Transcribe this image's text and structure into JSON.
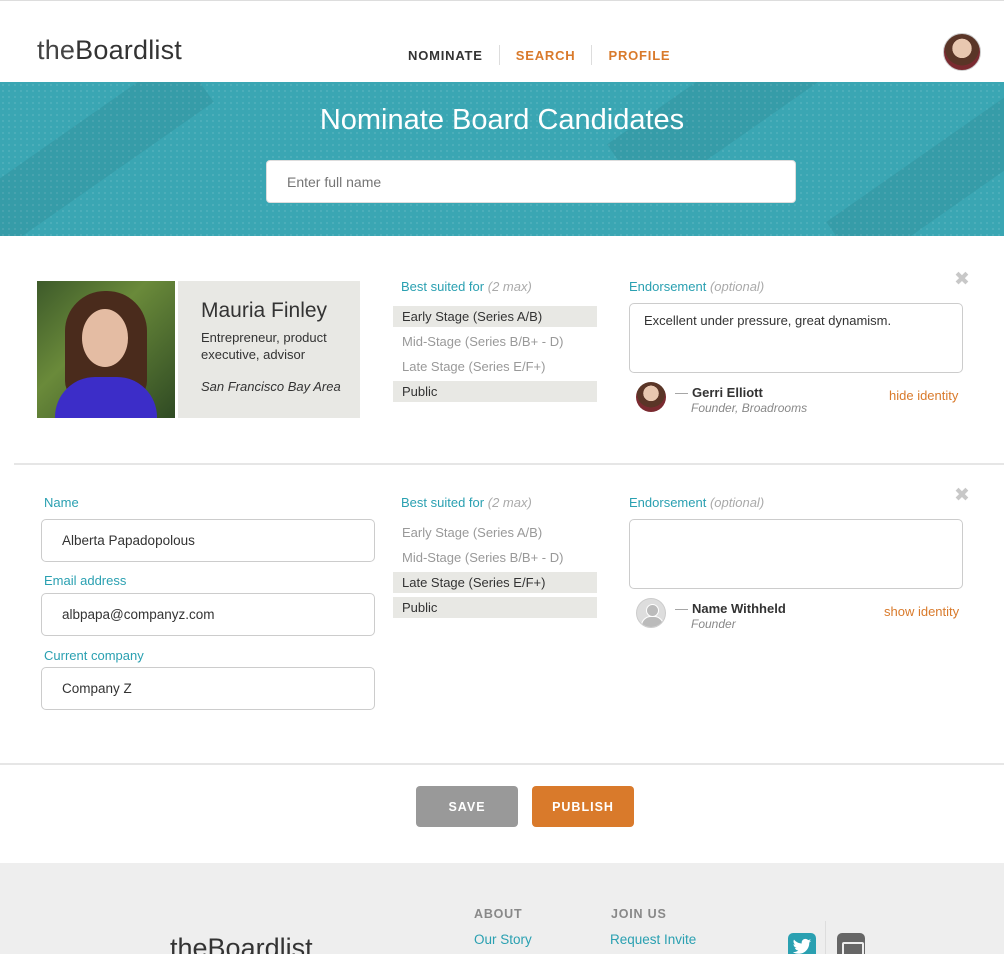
{
  "header": {
    "logo_prefix": "the",
    "logo_brand": "Boardlist",
    "nav": [
      "NOMINATE",
      "SEARCH",
      "PROFILE"
    ]
  },
  "banner": {
    "title": "Nominate Board Candidates",
    "search_placeholder": "Enter full name"
  },
  "candidate1": {
    "name": "Mauria Finley",
    "title": "Entrepreneur, product executive, advisor",
    "location": "San Francisco Bay Area",
    "best_suited_label": "Best suited for",
    "best_suited_hint": "(2 max)",
    "stages": [
      "Early Stage (Series A/B)",
      "Mid-Stage (Series B/B+ - D)",
      "Late Stage (Series E/F+)",
      "Public"
    ],
    "selected_stages": [
      "Early Stage (Series A/B)",
      "Public"
    ],
    "endorsement_label": "Endorsement",
    "endorsement_hint": "(optional)",
    "endorsement_text": "Excellent under pressure, great dynamism.",
    "endorser_dash": "—",
    "endorser_name": "Gerri Elliott",
    "endorser_role": "Founder, Broadrooms",
    "identity_link": "hide identity",
    "close_icon": "✖"
  },
  "candidate2": {
    "name_label": "Name",
    "name_value": "Alberta Papadopolous",
    "email_label": "Email address",
    "email_value": "albpapa@companyz.com",
    "company_label": "Current company",
    "company_value": "Company Z",
    "best_suited_label": "Best suited for",
    "best_suited_hint": "(2 max)",
    "stages": [
      "Early Stage (Series A/B)",
      "Mid-Stage (Series B/B+ - D)",
      "Late Stage (Series E/F+)",
      "Public"
    ],
    "selected_stages": [
      "Late Stage (Series E/F+)",
      "Public"
    ],
    "endorsement_label": "Endorsement",
    "endorsement_hint": "(optional)",
    "endorsement_text": "",
    "endorser_dash": "—",
    "endorser_name": "Name Withheld",
    "endorser_role": "Founder",
    "identity_link": "show identity",
    "close_icon": "✖"
  },
  "actions": {
    "save": "SAVE",
    "publish": "PUBLISH"
  },
  "footer": {
    "logo_prefix": "the",
    "logo_brand": "Boardlist",
    "about_heading": "ABOUT",
    "about_link": "Our Story",
    "join_heading": "JOIN US",
    "join_link": "Request Invite",
    "social_icons": [
      "twitter-icon",
      "mail-icon"
    ]
  },
  "colors": {
    "accent_teal": "#3aa6b3",
    "accent_orange": "#d97a2b",
    "label_teal": "#2aa0b1"
  }
}
